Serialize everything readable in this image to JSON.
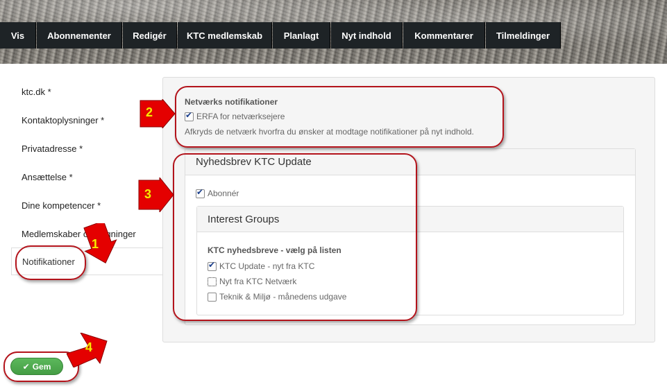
{
  "tabs": [
    "Vis",
    "Abonnementer",
    "Redigér",
    "KTC medlemskab",
    "Planlagt",
    "Nyt indhold",
    "Kommentarer",
    "Tilmeldinger"
  ],
  "sidebar": {
    "items": [
      {
        "label": "ktc.dk *"
      },
      {
        "label": "Kontaktoplysninger *"
      },
      {
        "label": "Privatadresse *"
      },
      {
        "label": "Ansættelse *"
      },
      {
        "label": "Dine kompetencer *"
      },
      {
        "label": "Medlemskaber og begninger"
      },
      {
        "label": "Notifikationer",
        "active": true
      }
    ]
  },
  "network": {
    "heading": "Netværks notifikationer",
    "option": {
      "label": "ERFA for netværksejere",
      "checked": true
    },
    "help": "Afkryds de netværk hvorfra du ønsker at modtage notifikationer på nyt indhold."
  },
  "newsletter": {
    "heading": "Nyhedsbrev KTC Update",
    "subscribe": {
      "label": "Abonnér",
      "checked": true
    },
    "interest_groups": {
      "heading": "Interest Groups",
      "subheading": "KTC nyhedsbreve - vælg på listen",
      "options": [
        {
          "label": "KTC Update - nyt fra KTC",
          "checked": true
        },
        {
          "label": "Nyt fra KTC Netværk",
          "checked": false
        },
        {
          "label": "Teknik & Miljø - månedens udgave",
          "checked": false
        }
      ]
    }
  },
  "save_label": "Gem",
  "callouts": [
    "1",
    "2",
    "3",
    "4"
  ],
  "colors": {
    "tab_bg": "#1e2326",
    "annotation": "#b3131b",
    "save_green": "#5cb85c",
    "badge_red": "#e40000"
  }
}
